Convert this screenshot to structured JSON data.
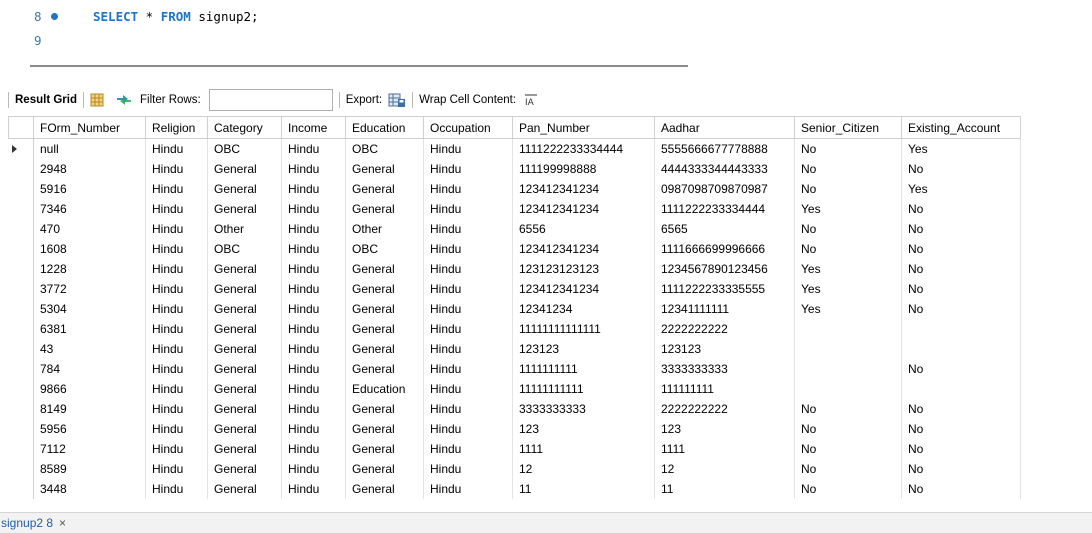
{
  "editor": {
    "lines": [
      {
        "num": "8",
        "kw1": "SELECT",
        "mid": " * ",
        "kw2": "FROM",
        "rest": " signup2;"
      },
      {
        "num": "9"
      }
    ]
  },
  "toolbar": {
    "result_grid": "Result Grid",
    "filter_rows": "Filter Rows:",
    "filter_value": "",
    "export": "Export:",
    "wrap": "Wrap Cell Content:",
    "wrap_icon_text": "IA"
  },
  "grid": {
    "columns": [
      "FOrm_Number",
      "Religion",
      "Category",
      "Income",
      "Education",
      "Occupation",
      "Pan_Number",
      "Aadhar",
      "Senior_Citizen",
      "Existing_Account"
    ],
    "rows": [
      [
        "null",
        "Hindu",
        "OBC",
        "Hindu",
        "OBC",
        "Hindu",
        "1111222233334444",
        "5555666677778888",
        "No",
        "Yes"
      ],
      [
        "2948",
        "Hindu",
        "General",
        "Hindu",
        "General",
        "Hindu",
        "111199998888",
        "4444333344443333",
        "No",
        "No"
      ],
      [
        "5916",
        "Hindu",
        "General",
        "Hindu",
        "General",
        "Hindu",
        "123412341234",
        "0987098709870987",
        "No",
        "Yes"
      ],
      [
        "7346",
        "Hindu",
        "General",
        "Hindu",
        "General",
        "Hindu",
        "123412341234",
        "1111222233334444",
        "Yes",
        "No"
      ],
      [
        "470",
        "Hindu",
        "Other",
        "Hindu",
        "Other",
        "Hindu",
        "6556",
        "6565",
        "No",
        "No"
      ],
      [
        "1608",
        "Hindu",
        "OBC",
        "Hindu",
        "OBC",
        "Hindu",
        "123412341234",
        "1111666699996666",
        "No",
        "No"
      ],
      [
        "1228",
        "Hindu",
        "General",
        "Hindu",
        "General",
        "Hindu",
        "123123123123",
        "1234567890123456",
        "Yes",
        "No"
      ],
      [
        "3772",
        "Hindu",
        "General",
        "Hindu",
        "General",
        "Hindu",
        "123412341234",
        "1111222233335555",
        "Yes",
        "No"
      ],
      [
        "5304",
        "Hindu",
        "General",
        "Hindu",
        "General",
        "Hindu",
        "12341234",
        "12341111111",
        "Yes",
        "No"
      ],
      [
        "6381",
        "Hindu",
        "General",
        "Hindu",
        "General",
        "Hindu",
        "11111111111111",
        "2222222222",
        "",
        ""
      ],
      [
        "43",
        "Hindu",
        "General",
        "Hindu",
        "General",
        "Hindu",
        "123123",
        "123123",
        "",
        ""
      ],
      [
        "784",
        "Hindu",
        "General",
        "Hindu",
        "General",
        "Hindu",
        "1111111111",
        "3333333333",
        "",
        "No"
      ],
      [
        "9866",
        "Hindu",
        "General",
        "Hindu",
        "Education",
        "Hindu",
        "11111111111",
        "111111111",
        "",
        ""
      ],
      [
        "8149",
        "Hindu",
        "General",
        "Hindu",
        "General",
        "Hindu",
        "3333333333",
        "2222222222",
        "No",
        "No"
      ],
      [
        "5956",
        "Hindu",
        "General",
        "Hindu",
        "General",
        "Hindu",
        "123",
        "123",
        "No",
        "No"
      ],
      [
        "7112",
        "Hindu",
        "General",
        "Hindu",
        "General",
        "Hindu",
        "1111",
        "1111",
        "No",
        "No"
      ],
      [
        "8589",
        "Hindu",
        "General",
        "Hindu",
        "General",
        "Hindu",
        "12",
        "12",
        "No",
        "No"
      ],
      [
        "3448",
        "Hindu",
        "General",
        "Hindu",
        "General",
        "Hindu",
        "11",
        "11",
        "No",
        "No"
      ]
    ]
  },
  "tabs": [
    {
      "label": "signup2 8",
      "close": "×"
    }
  ],
  "colors": {
    "keyword": "#1f74c6",
    "line_number": "#3a7ca8",
    "tab_text": "#1f5fa8"
  }
}
